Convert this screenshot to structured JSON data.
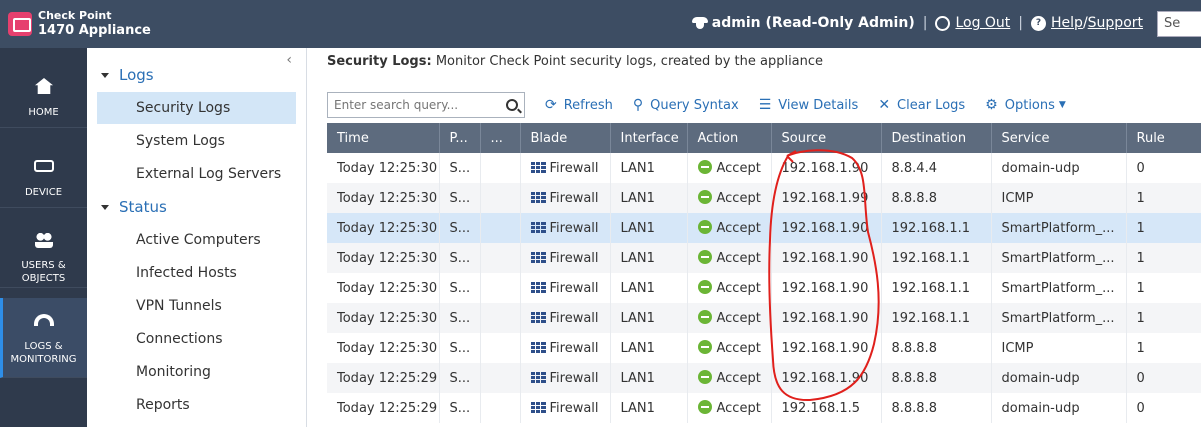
{
  "header": {
    "brand_line1": "Check Point",
    "brand_line2": "1470 Appliance",
    "user": "admin (Read-Only Admin)",
    "logout": "Log Out",
    "help": "Help",
    "support": "Support",
    "search_placeholder": "Se",
    "sep": "|",
    "slash": "/"
  },
  "nav": [
    {
      "label": "HOME"
    },
    {
      "label": "DEVICE"
    },
    {
      "label": "USERS &",
      "label2": "OBJECTS"
    },
    {
      "label": "LOGS &",
      "label2": "MONITORING"
    }
  ],
  "tree": {
    "collapse": "‹",
    "logs": "Logs",
    "logs_items": [
      "Security Logs",
      "System Logs",
      "External Log Servers"
    ],
    "status": "Status",
    "status_items": [
      "Active Computers",
      "Infected Hosts",
      "VPN Tunnels",
      "Connections",
      "Monitoring",
      "Reports"
    ]
  },
  "page": {
    "title": "Security Logs:",
    "desc": " Monitor Check Point security logs, created by the appliance"
  },
  "toolbar": {
    "search_placeholder": "Enter search query...",
    "refresh": "Refresh",
    "query_syntax": "Query Syntax",
    "view_details": "View Details",
    "clear_logs": "Clear Logs",
    "options": "Options"
  },
  "table": {
    "columns": [
      "Time",
      "P...",
      "...",
      "Blade",
      "Interface",
      "Action",
      "Source",
      "Destination",
      "Service",
      "Rule"
    ],
    "rows": [
      [
        "Today 12:25:30",
        "S...",
        "",
        "Firewall",
        "LAN1",
        "Accept",
        "192.168.1.90",
        "8.8.4.4",
        "domain-udp",
        "0"
      ],
      [
        "Today 12:25:30",
        "S...",
        "",
        "Firewall",
        "LAN1",
        "Accept",
        "192.168.1.99",
        "8.8.8.8",
        "ICMP",
        "1"
      ],
      [
        "Today 12:25:30",
        "S...",
        "",
        "Firewall",
        "LAN1",
        "Accept",
        "192.168.1.90",
        "192.168.1.1",
        "SmartPlatform_...",
        "1"
      ],
      [
        "Today 12:25:30",
        "S...",
        "",
        "Firewall",
        "LAN1",
        "Accept",
        "192.168.1.90",
        "192.168.1.1",
        "SmartPlatform_...",
        "1"
      ],
      [
        "Today 12:25:30",
        "S...",
        "",
        "Firewall",
        "LAN1",
        "Accept",
        "192.168.1.90",
        "192.168.1.1",
        "SmartPlatform_...",
        "1"
      ],
      [
        "Today 12:25:30",
        "S...",
        "",
        "Firewall",
        "LAN1",
        "Accept",
        "192.168.1.90",
        "192.168.1.1",
        "SmartPlatform_...",
        "1"
      ],
      [
        "Today 12:25:30",
        "S...",
        "",
        "Firewall",
        "LAN1",
        "Accept",
        "192.168.1.90",
        "8.8.8.8",
        "ICMP",
        "1"
      ],
      [
        "Today 12:25:29",
        "S...",
        "",
        "Firewall",
        "LAN1",
        "Accept",
        "192.168.1.90",
        "8.8.8.8",
        "domain-udp",
        "0"
      ],
      [
        "Today 12:25:29",
        "S...",
        "",
        "Firewall",
        "LAN1",
        "Accept",
        "192.168.1.5",
        "8.8.8.8",
        "domain-udp",
        "0"
      ]
    ],
    "selected_row": 2
  },
  "colors": {
    "topbar": "#3d4d63",
    "nav": "#2f3a4c",
    "accent": "#2a6fb5",
    "header_row": "#5d6b7e",
    "accept": "#6bb536",
    "annotation": "#e0201c"
  }
}
